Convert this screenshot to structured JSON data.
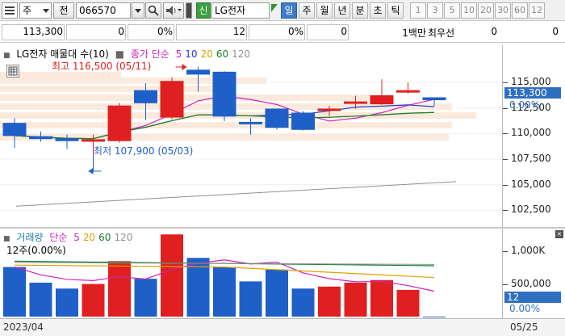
{
  "toolbar": {
    "market_select": "주",
    "tab_label": "전",
    "stock_code": "066570",
    "badge": "신",
    "stock_name": "LG전자",
    "periods": [
      "일",
      "주",
      "월",
      "년",
      "분",
      "초",
      "틱"
    ],
    "active_period": "일",
    "numbers": [
      "1",
      "3",
      "5",
      "10",
      "20",
      "30",
      "60",
      "12"
    ]
  },
  "infobar": {
    "price": "113,300",
    "change": "0",
    "change_rate": "0%",
    "volume": "12",
    "vol_rate": "0%",
    "field6": "0",
    "unit_label": "1백만",
    "best_bid_label": "최우선",
    "best_bid_value": "0",
    "field9": "0"
  },
  "price_panel": {
    "legend_name": "LG전자 매물대 수(10)",
    "legend_ma_label": "종가 단순",
    "legend_periods": [
      "5",
      "10",
      "20",
      "60",
      "120"
    ],
    "legend_colors": [
      "#d020c0",
      "#2040d0",
      "#e0a000",
      "#108030",
      "#909090"
    ],
    "high_label": "최고 116,500 (05/11)",
    "low_label": "최저 107,900 (05/03)",
    "y_ticks": [
      "115,000",
      "112,500",
      "110,000",
      "107,500",
      "105,000",
      "102,500"
    ],
    "current_tag": "113,300",
    "current_pct": "0.00%"
  },
  "volume_panel": {
    "legend_title": "거래량",
    "legend_ma_label": "단순",
    "legend_periods": [
      "5",
      "20",
      "60",
      "120"
    ],
    "legend_colors": [
      "#d020c0",
      "#e0a000",
      "#108030",
      "#909090"
    ],
    "sub_label": "12주(0.00%)",
    "y_ticks": [
      "1,000K",
      "500,000"
    ],
    "current_tag": "12",
    "current_pct": "0.00%"
  },
  "dates": {
    "start": "2023/04",
    "end": "05/25"
  },
  "colors": {
    "up": "#e02020",
    "down": "#1f5fc8",
    "accent": "#3d7cc9"
  },
  "chart_data": [
    {
      "type": "candlestick",
      "title": "LG전자",
      "ylim": [
        101500,
        118000
      ],
      "series": [
        {
          "name": "price",
          "values": [
            {
              "o": 111000,
              "h": 111500,
              "l": 108600,
              "c": 109800
            },
            {
              "o": 109700,
              "h": 110200,
              "l": 109200,
              "c": 109500
            },
            {
              "o": 109500,
              "h": 109900,
              "l": 108500,
              "c": 109300
            },
            {
              "o": 109300,
              "h": 109900,
              "l": 107900,
              "c": 109400
            },
            {
              "o": 109300,
              "h": 113000,
              "l": 109100,
              "c": 112700
            },
            {
              "o": 114200,
              "h": 114900,
              "l": 111300,
              "c": 113000
            },
            {
              "o": 111600,
              "h": 115500,
              "l": 111400,
              "c": 115100
            },
            {
              "o": 116200,
              "h": 116500,
              "l": 114100,
              "c": 115800
            },
            {
              "o": 116000,
              "h": 116100,
              "l": 111200,
              "c": 111700
            },
            {
              "o": 111100,
              "h": 111500,
              "l": 109900,
              "c": 111000
            },
            {
              "o": 112400,
              "h": 112400,
              "l": 110400,
              "c": 110600
            },
            {
              "o": 112000,
              "h": 112200,
              "l": 110300,
              "c": 110400
            },
            {
              "o": 112400,
              "h": 112700,
              "l": 111700,
              "c": 112400
            },
            {
              "o": 113100,
              "h": 113700,
              "l": 112400,
              "c": 113100
            },
            {
              "o": 112900,
              "h": 115300,
              "l": 112800,
              "c": 113700
            },
            {
              "o": 114200,
              "h": 115000,
              "l": 113900,
              "c": 114200
            },
            {
              "o": 113500,
              "h": 113500,
              "l": 112700,
              "c": 113300
            }
          ]
        }
      ]
    },
    {
      "type": "bar",
      "title": "거래량",
      "ylim": [
        0,
        1300000
      ],
      "values": [
        760000,
        520000,
        430000,
        500000,
        850000,
        580000,
        1260000,
        900000,
        760000,
        540000,
        720000,
        430000,
        460000,
        520000,
        560000,
        410000,
        12
      ]
    }
  ]
}
